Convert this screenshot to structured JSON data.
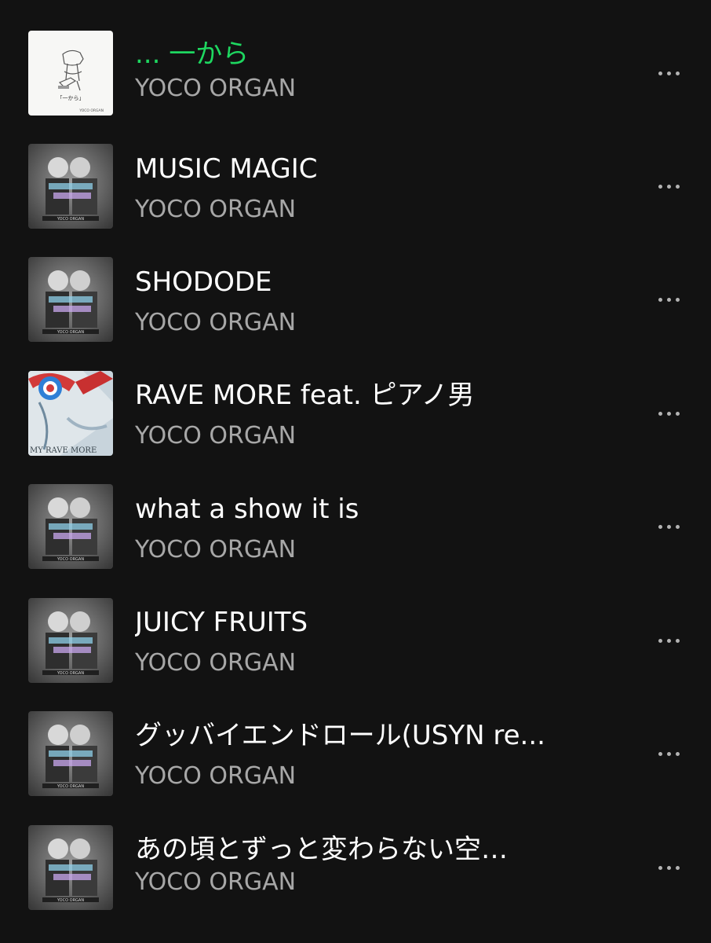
{
  "colors": {
    "background": "#121212",
    "title": "#ffffff",
    "playing_title": "#1ed760",
    "artist": "#a7a7a7",
    "more_dots": "#b3b3b3"
  },
  "tracks": [
    {
      "title": "... 一から",
      "artist": "YOCO ORGAN",
      "playing": true,
      "artwork": "white-sketch-cover",
      "artwork_text": "「一から」",
      "artwork_credit": "YOCO ORGAN",
      "more_icon": "more-horizontal-icon"
    },
    {
      "title": "MUSIC MAGIC",
      "artist": "YOCO ORGAN",
      "playing": false,
      "artwork": "grey-duo-portrait-cover",
      "artwork_credit": "YOCO ORGAN",
      "more_icon": "more-horizontal-icon"
    },
    {
      "title": "SHODODE",
      "artist": "YOCO ORGAN",
      "playing": false,
      "artwork": "grey-duo-portrait-cover",
      "artwork_credit": "YOCO ORGAN",
      "more_icon": "more-horizontal-icon"
    },
    {
      "title": "RAVE MORE feat. ピアノ男",
      "artist": "YOCO ORGAN",
      "playing": false,
      "artwork": "rave-more-cover",
      "artwork_text": "MY RAVE MORE",
      "more_icon": "more-horizontal-icon"
    },
    {
      "title": "what a show it is",
      "artist": "YOCO ORGAN",
      "playing": false,
      "artwork": "grey-duo-portrait-cover",
      "artwork_credit": "YOCO ORGAN",
      "more_icon": "more-horizontal-icon"
    },
    {
      "title": "JUICY FRUITS",
      "artist": "YOCO ORGAN",
      "playing": false,
      "artwork": "grey-duo-portrait-cover",
      "artwork_credit": "YOCO ORGAN",
      "more_icon": "more-horizontal-icon"
    },
    {
      "title": "グッバイエンドロール(USYN re...",
      "artist": "YOCO ORGAN",
      "playing": false,
      "artwork": "grey-duo-portrait-cover",
      "artwork_credit": "YOCO ORGAN",
      "more_icon": "more-horizontal-icon"
    },
    {
      "title": "あの頃とずっと変わらない空…",
      "artist": "YOCO ORGAN",
      "playing": false,
      "artwork": "grey-duo-portrait-cover",
      "artwork_credit": "YOCO ORGAN",
      "more_icon": "more-horizontal-icon"
    }
  ]
}
